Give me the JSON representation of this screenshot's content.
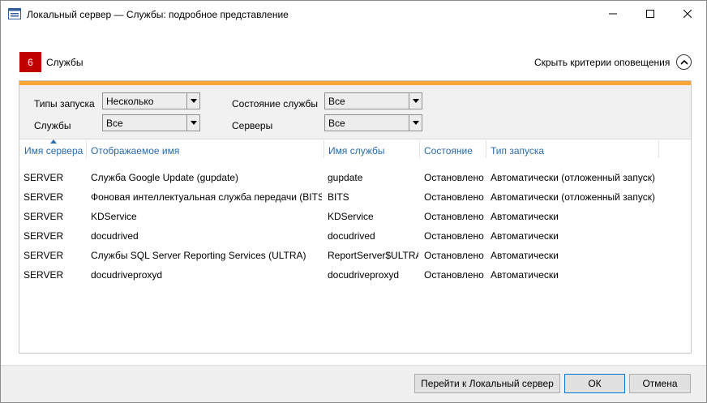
{
  "window": {
    "title": "Локальный сервер — Службы: подробное представление",
    "minimize_symbol": "—",
    "maximize_symbol": "☐",
    "close_symbol": "✕"
  },
  "header": {
    "count": "6",
    "section_title": "Службы",
    "hide_criteria_label": "Скрыть критерии оповещения"
  },
  "filters": {
    "startup_types_label": "Типы запуска",
    "startup_types_value": "Несколько",
    "service_state_label": "Состояние службы",
    "service_state_value": "Все",
    "services_label": "Службы",
    "services_value": "Все",
    "servers_label": "Серверы",
    "servers_value": "Все"
  },
  "table": {
    "columns": [
      "Имя сервера",
      "Отображаемое имя",
      "Имя службы",
      "Состояние",
      "Тип запуска"
    ],
    "rows": [
      [
        "SERVER",
        "Служба Google Update (gupdate)",
        "gupdate",
        "Остановлено",
        "Автоматически (отложенный запуск)"
      ],
      [
        "SERVER",
        "Фоновая интеллектуальная служба передачи (BITS)",
        "BITS",
        "Остановлено",
        "Автоматически (отложенный запуск)"
      ],
      [
        "SERVER",
        "KDService",
        "KDService",
        "Остановлено",
        "Автоматически"
      ],
      [
        "SERVER",
        "docudrived",
        "docudrived",
        "Остановлено",
        "Автоматически"
      ],
      [
        "SERVER",
        "Службы SQL Server Reporting Services (ULTRA)",
        "ReportServer$ULTRA",
        "Остановлено",
        "Автоматически"
      ],
      [
        "SERVER",
        "docudriveproxyd",
        "docudriveproxyd",
        "Остановлено",
        "Автоматически"
      ]
    ]
  },
  "footer": {
    "goto_label": "Перейти к Локальный сервер",
    "ok_label": "ОК",
    "cancel_label": "Отмена"
  },
  "colors": {
    "badge": "#c00000",
    "accent_bar": "#f8a534",
    "header_link": "#2a6ba8",
    "ok_border": "#0078d7"
  },
  "icons": {
    "app": "server-manager-icon",
    "collapse": "chevron-up-icon",
    "sort": "sort-ascending-icon",
    "dropdown": "dropdown-arrow-icon"
  }
}
